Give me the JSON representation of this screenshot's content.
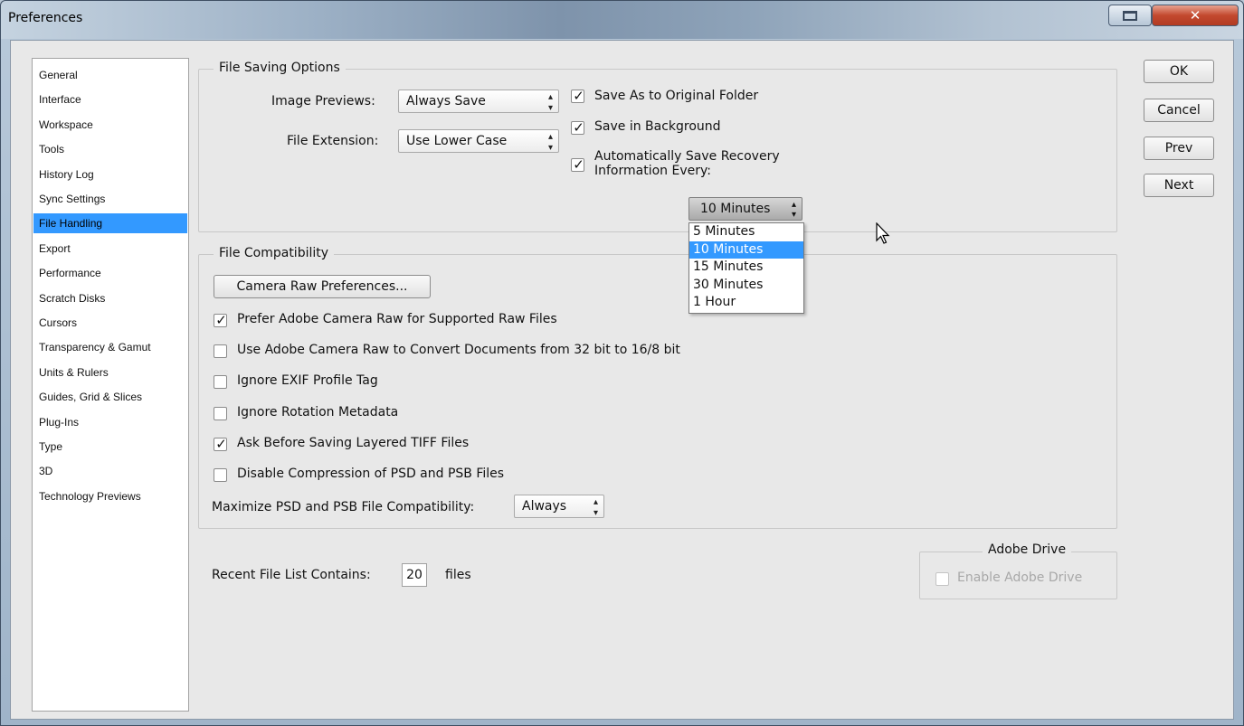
{
  "window": {
    "title": "Preferences"
  },
  "sidebar": {
    "items": [
      {
        "label": "General"
      },
      {
        "label": "Interface"
      },
      {
        "label": "Workspace"
      },
      {
        "label": "Tools"
      },
      {
        "label": "History Log"
      },
      {
        "label": "Sync Settings"
      },
      {
        "label": "File Handling",
        "selected": true
      },
      {
        "label": "Export"
      },
      {
        "label": "Performance"
      },
      {
        "label": "Scratch Disks"
      },
      {
        "label": "Cursors"
      },
      {
        "label": "Transparency & Gamut"
      },
      {
        "label": "Units & Rulers"
      },
      {
        "label": "Guides, Grid & Slices"
      },
      {
        "label": "Plug-Ins"
      },
      {
        "label": "Type"
      },
      {
        "label": "3D"
      },
      {
        "label": "Technology Previews"
      }
    ]
  },
  "file_saving": {
    "title": "File Saving Options",
    "image_previews_label": "Image Previews:",
    "image_previews_value": "Always Save",
    "file_extension_label": "File Extension:",
    "file_extension_value": "Use Lower Case",
    "save_as_original": {
      "label": "Save As to Original Folder",
      "checked": true
    },
    "save_background": {
      "label": "Save in Background",
      "checked": true
    },
    "auto_save_line1": "Automatically Save Recovery",
    "auto_save_line2": "Information Every:",
    "auto_save_checked": true,
    "interval_value": "10 Minutes",
    "interval_options": [
      "5 Minutes",
      "10 Minutes",
      "15 Minutes",
      "30 Minutes",
      "1 Hour"
    ],
    "interval_selected_index": 1
  },
  "compat": {
    "title": "File Compatibility",
    "camera_raw_button": "Camera Raw Preferences...",
    "options": [
      {
        "label": "Prefer Adobe Camera Raw for Supported Raw Files",
        "checked": true
      },
      {
        "label": "Use Adobe Camera Raw to Convert Documents from 32 bit to 16/8 bit",
        "checked": false
      },
      {
        "label": "Ignore EXIF Profile Tag",
        "checked": false
      },
      {
        "label": "Ignore Rotation Metadata",
        "checked": false
      },
      {
        "label": "Ask Before Saving Layered TIFF Files",
        "checked": true
      },
      {
        "label": "Disable Compression of PSD and PSB Files",
        "checked": false
      }
    ],
    "maximize_label": "Maximize PSD and PSB File Compatibility:",
    "maximize_value": "Always"
  },
  "recent": {
    "label": "Recent File List Contains:",
    "value": "20",
    "suffix": "files"
  },
  "adobe_drive": {
    "title": "Adobe Drive",
    "enable_label": "Enable Adobe Drive",
    "checked": false,
    "enabled": false
  },
  "buttons": {
    "ok": "OK",
    "cancel": "Cancel",
    "prev": "Prev",
    "next": "Next"
  },
  "glyphs": {
    "check": "✓",
    "close": "✕",
    "updown": "⬍"
  }
}
